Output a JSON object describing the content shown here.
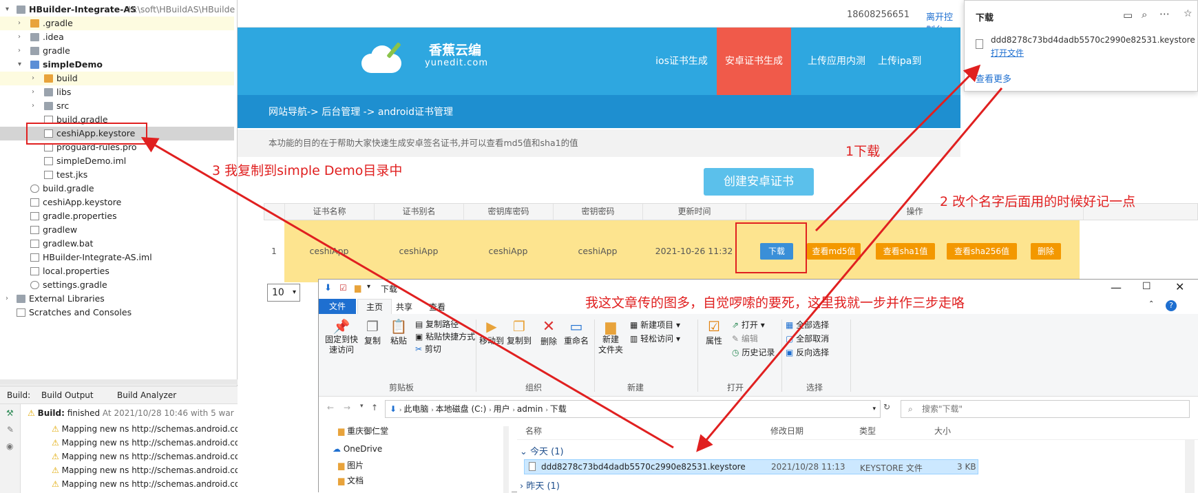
{
  "ide": {
    "root": "HBuilder-Integrate-AS",
    "root_path": "H:\\soft\\HBuildAS\\HBuilde",
    "tree": [
      {
        "label": "HBuilder-Integrate-AS",
        "indent": 0
      },
      {
        "label": ".gradle"
      },
      {
        "label": ".idea"
      },
      {
        "label": "gradle"
      },
      {
        "label": "simpleDemo"
      },
      {
        "label": "build"
      },
      {
        "label": "libs"
      },
      {
        "label": "src"
      },
      {
        "label": "build.gradle"
      },
      {
        "label": "ceshiApp.keystore"
      },
      {
        "label": "proguard-rules.pro"
      },
      {
        "label": "simpleDemo.iml"
      },
      {
        "label": "test.jks"
      },
      {
        "label": "build.gradle"
      },
      {
        "label": "ceshiApp.keystore"
      },
      {
        "label": "gradle.properties"
      },
      {
        "label": "gradlew"
      },
      {
        "label": "gradlew.bat"
      },
      {
        "label": "HBuilder-Integrate-AS.iml"
      },
      {
        "label": "local.properties"
      },
      {
        "label": "settings.gradle"
      },
      {
        "label": "External Libraries"
      },
      {
        "label": "Scratches and Consoles"
      }
    ],
    "build": {
      "tab_label": "Build:",
      "tabs": [
        "Build Output",
        "Build Analyzer"
      ],
      "status": "Build:",
      "status_rest": "finished",
      "status_time": "At 2021/10/28 10:46 with 5 war",
      "warnings": [
        "Mapping new ns http://schemas.android.co",
        "Mapping new ns http://schemas.android.co",
        "Mapping new ns http://schemas.android.co",
        "Mapping new ns http://schemas.android.co",
        "Mapping new ns http://schemas.android.co"
      ]
    }
  },
  "site": {
    "phone": "18608256651",
    "console_link": "离开控制台",
    "logo_cn": "香蕉云编",
    "logo_en": "yunedit.com",
    "nav": [
      "ios证书生成",
      "安卓证书生成",
      "上传应用内测",
      "上传ipa到appstore"
    ],
    "breadcrumb": "网站导航-> 后台管理 -> android证书管理",
    "notice": "本功能的目的在于帮助大家快速生成安卓签名证书,并可以查看md5值和sha1的值",
    "create_button": "创建安卓证书",
    "columns": [
      "证书名称",
      "证书别名",
      "密钥库密码",
      "密钥密码",
      "更新时间",
      "操作"
    ],
    "row": {
      "index": "1",
      "name": "ceshiApp",
      "alias": "ceshiApp",
      "store_pwd": "ceshiApp",
      "key_pwd": "ceshiApp",
      "updated": "2021-10-26 11:32"
    },
    "actions": [
      "下载",
      "查看md5值",
      "查看sha1值",
      "查看sha256值",
      "删除"
    ],
    "page_size": "10"
  },
  "downloads": {
    "title": "下载",
    "file": "ddd8278c73bd4dadb5570c2990e82531.keystore",
    "open_link": "打开文件",
    "more_link": "查看更多"
  },
  "explorer": {
    "title": "下载",
    "tabs": [
      "文件",
      "主页",
      "共享",
      "查看"
    ],
    "ribbon": {
      "pin": "固定到快\n速访问",
      "copy": "复制",
      "paste": "粘贴",
      "copy_path": "复制路径",
      "paste_shortcut": "粘贴快捷方式",
      "cut": "剪切",
      "clipboard": "剪贴板",
      "move_to": "移动到",
      "copy_to": "复制到",
      "delete": "删除",
      "rename": "重命名",
      "organize": "组织",
      "new_folder": "新建\n文件夹",
      "new_item": "新建项目",
      "easy_access": "轻松访问",
      "new_group": "新建",
      "properties": "属性",
      "open": "打开",
      "edit": "编辑",
      "history": "历史记录",
      "open_group": "打开",
      "select_all": "全部选择",
      "select_none": "全部取消",
      "invert": "反向选择",
      "select_group": "选择"
    },
    "path": [
      "此电脑",
      "本地磁盘 (C:)",
      "用户",
      "admin",
      "下载"
    ],
    "search_placeholder": "搜索\"下载\"",
    "nav_items": [
      "重庆御仁堂",
      "OneDrive",
      "图片",
      "文档"
    ],
    "cols": [
      "名称",
      "修改日期",
      "类型",
      "大小"
    ],
    "group_today": "今天 (1)",
    "group_yesterday": "昨天 (1)",
    "file_row": {
      "name": "ddd8278c73bd4dadb5570c2990e82531.keystore",
      "date": "2021/10/28 11:13",
      "type": "KEYSTORE 文件",
      "size": "3 KB"
    }
  },
  "annotations": {
    "a1": "1下载",
    "a2": "2 改个名字后面用的时候好记一点",
    "a3": "3 我复制到simple Demo目录中",
    "a4": "我这文章传的图多，自觉啰嗦的要死，这里我就一步并作三步走咯"
  },
  "colors": {
    "header_blue": "#2ea7e0",
    "nav_active": "#f05a4a",
    "row_yellow": "#fde48f",
    "orange_btn": "#f39800",
    "download_btn": "#3a8fd8",
    "annotation_red": "#e02020"
  }
}
